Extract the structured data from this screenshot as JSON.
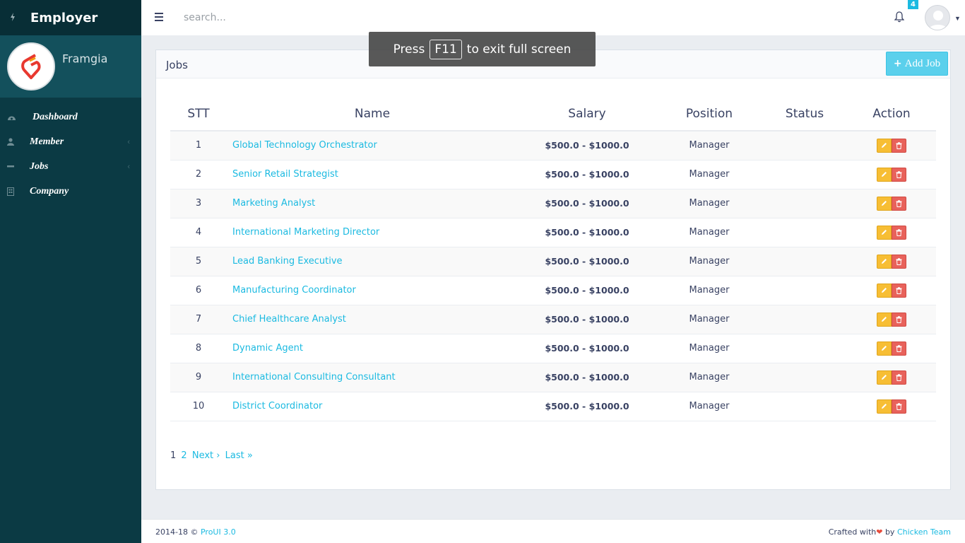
{
  "brand": {
    "title": "Employer",
    "icon": "bolt-icon"
  },
  "profile": {
    "name": "Framgia"
  },
  "sidebar": {
    "items": [
      {
        "label": "Dashboard",
        "icon": "dashboard-icon"
      },
      {
        "label": "Member",
        "icon": "user-icon",
        "has_submenu": true
      },
      {
        "label": "Jobs",
        "icon": "minus-icon",
        "has_submenu": true
      },
      {
        "label": "Company",
        "icon": "building-icon"
      }
    ]
  },
  "header": {
    "search_placeholder": "search...",
    "notification_count": "4"
  },
  "fullscreen_notice": {
    "before": "Press",
    "key": "F11",
    "after": "to exit full screen"
  },
  "panel": {
    "title": "Jobs",
    "add_button": "Add Job"
  },
  "table": {
    "columns": [
      "STT",
      "Name",
      "Salary",
      "Position",
      "Status",
      "Action"
    ],
    "rows": [
      {
        "stt": "1",
        "name": "Global Technology Orchestrator",
        "salary": "$500.0 - $1000.0",
        "position": "Manager",
        "status": ""
      },
      {
        "stt": "2",
        "name": "Senior Retail Strategist",
        "salary": "$500.0 - $1000.0",
        "position": "Manager",
        "status": ""
      },
      {
        "stt": "3",
        "name": "Marketing Analyst",
        "salary": "$500.0 - $1000.0",
        "position": "Manager",
        "status": ""
      },
      {
        "stt": "4",
        "name": "International Marketing Director",
        "salary": "$500.0 - $1000.0",
        "position": "Manager",
        "status": ""
      },
      {
        "stt": "5",
        "name": "Lead Banking Executive",
        "salary": "$500.0 - $1000.0",
        "position": "Manager",
        "status": ""
      },
      {
        "stt": "6",
        "name": "Manufacturing Coordinator",
        "salary": "$500.0 - $1000.0",
        "position": "Manager",
        "status": ""
      },
      {
        "stt": "7",
        "name": "Chief Healthcare Analyst",
        "salary": "$500.0 - $1000.0",
        "position": "Manager",
        "status": ""
      },
      {
        "stt": "8",
        "name": "Dynamic Agent",
        "salary": "$500.0 - $1000.0",
        "position": "Manager",
        "status": ""
      },
      {
        "stt": "9",
        "name": "International Consulting Consultant",
        "salary": "$500.0 - $1000.0",
        "position": "Manager",
        "status": ""
      },
      {
        "stt": "10",
        "name": "District Coordinator",
        "salary": "$500.0 - $1000.0",
        "position": "Manager",
        "status": ""
      }
    ]
  },
  "pagination": {
    "current": "1",
    "page2": "2",
    "next": "Next ›",
    "last": "Last »"
  },
  "footer": {
    "left_text": "2014-18 ©",
    "left_link": "ProUI 3.0",
    "right_text": "Crafted with",
    "right_by": "by",
    "right_link": "Chicken Team"
  },
  "colors": {
    "sidebar_bg": "#0b3a44",
    "accent": "#1bbae1",
    "edit_button": "#f7be34",
    "delete_button": "#e8625b"
  }
}
